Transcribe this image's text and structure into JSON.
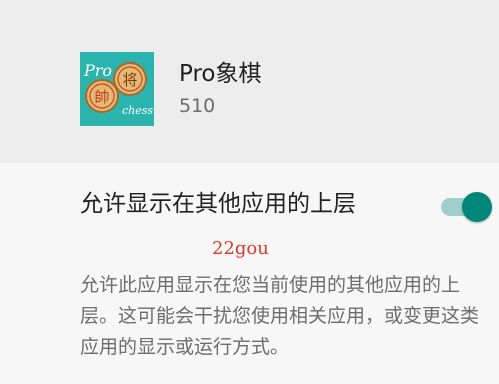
{
  "app": {
    "name": "Pro象棋",
    "version": "510",
    "icon": {
      "name": "chinese-chess-app-icon",
      "background": "#2bb3ad",
      "text_pro": "Pro",
      "text_chess": "chess",
      "piece_left": "帥",
      "piece_right": "将"
    }
  },
  "setting": {
    "label": "允许显示在其他应用的上层",
    "enabled": true,
    "accent_color": "#00877a"
  },
  "watermark": "22gou",
  "description": "允许此应用显示在您当前使用的其他应用的上层。这可能会干扰您使用相关应用，或变更这类应用的显示或运行方式。"
}
